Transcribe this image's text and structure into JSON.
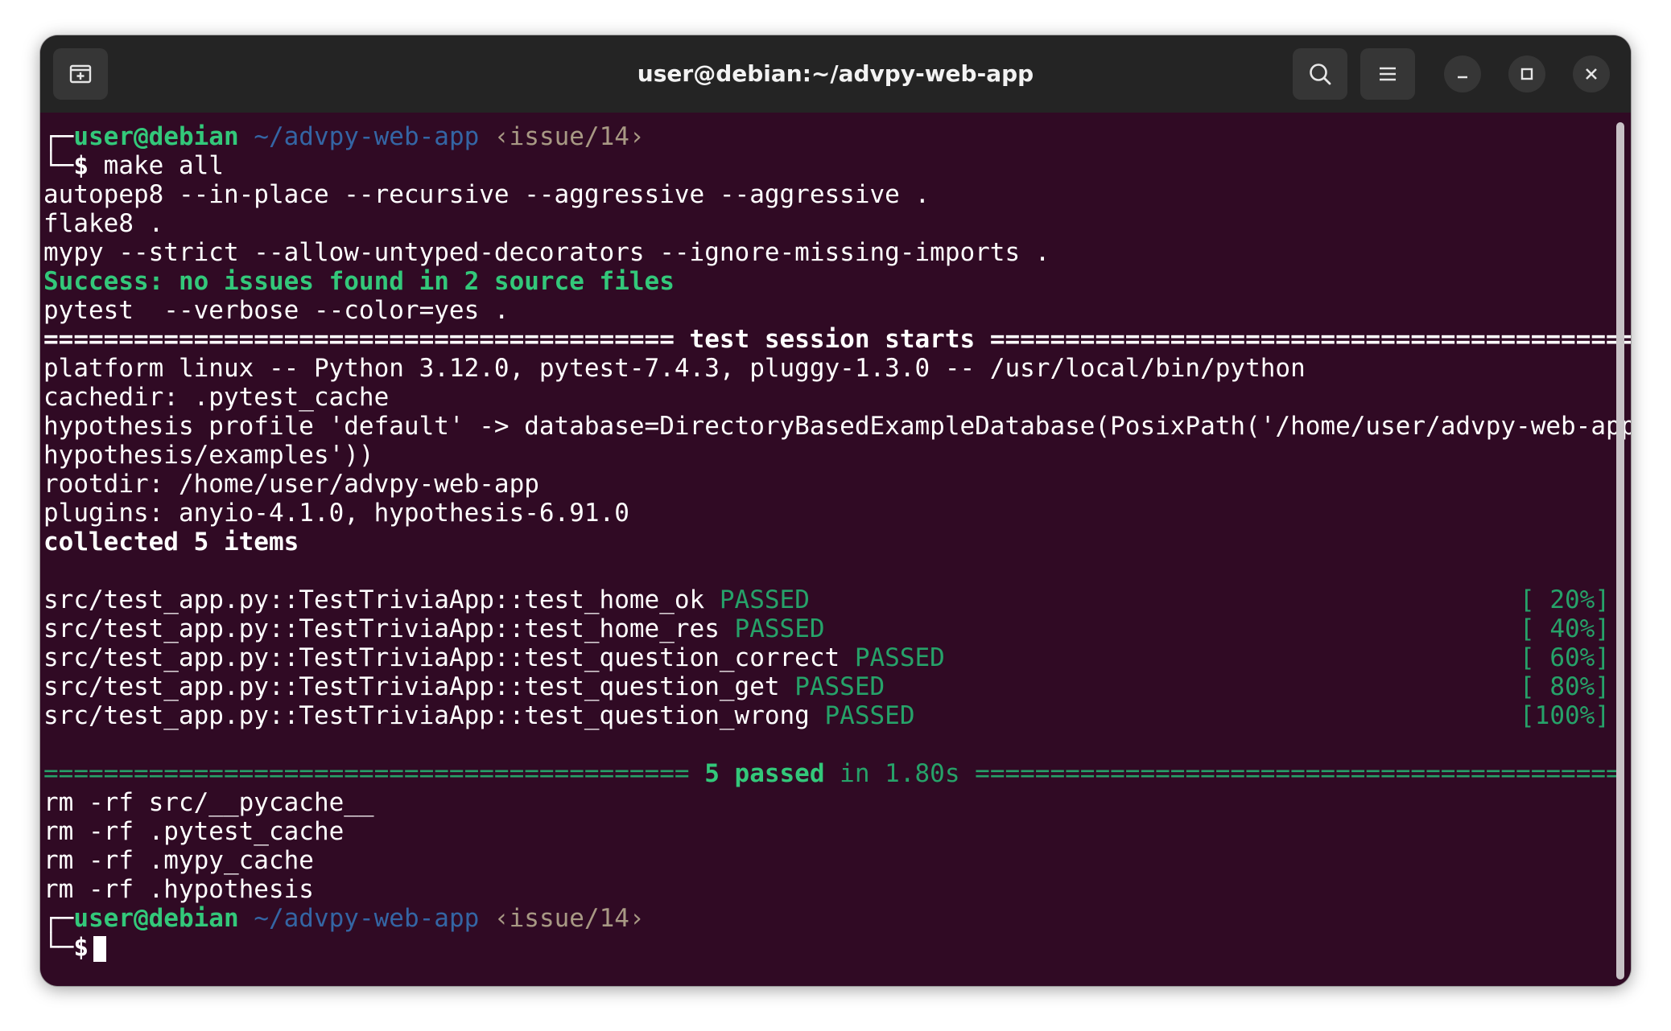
{
  "window": {
    "title": "user@debian:~/advpy-web-app"
  },
  "titlebar": {
    "icons": [
      "new-tab-icon",
      "search-icon",
      "hamburger-menu-icon",
      "minimize-icon",
      "maximize-icon",
      "close-icon"
    ]
  },
  "colors": {
    "background": "#300a24",
    "titlebar": "#242424",
    "green": "#26a269",
    "blue": "#3465a4",
    "branch": "#a89984"
  },
  "prompt1": {
    "corner_top": "┌─",
    "user": "user@debian",
    "path": "~/advpy-web-app",
    "branch": "‹issue/14›",
    "corner_bottom": "└─",
    "symbol": "$",
    "command": "make all"
  },
  "output": {
    "autopep8": "autopep8 --in-place --recursive --aggressive --aggressive .",
    "flake8": "flake8 .",
    "mypy": "mypy --strict --allow-untyped-decorators --ignore-missing-imports .",
    "mypy_success": "Success: no issues found in 2 source files",
    "pytest": "pytest  --verbose --color=yes .",
    "session_left": "========================================== ",
    "session_label": "test session starts",
    "session_right": " ===========================================",
    "platform": "platform linux -- Python 3.12.0, pytest-7.4.3, pluggy-1.3.0 -- /usr/local/bin/python",
    "cachedir": "cachedir: .pytest_cache",
    "hypothesis_1": "hypothesis profile 'default' -> database=DirectoryBasedExampleDatabase(PosixPath('/home/user/advpy-web-app/.",
    "hypothesis_2": "hypothesis/examples'))",
    "rootdir": "rootdir: /home/user/advpy-web-app",
    "plugins": "plugins: anyio-4.1.0, hypothesis-6.91.0",
    "collected": "collected 5 items"
  },
  "tests": [
    {
      "name": "src/test_app.py::TestTriviaApp::test_home_ok",
      "status": "PASSED",
      "open": "[",
      "pct": " 20%",
      "close": "]"
    },
    {
      "name": "src/test_app.py::TestTriviaApp::test_home_res",
      "status": "PASSED",
      "open": "[",
      "pct": " 40%",
      "close": "]"
    },
    {
      "name": "src/test_app.py::TestTriviaApp::test_question_correct",
      "status": "PASSED",
      "open": "[",
      "pct": " 60%",
      "close": "]"
    },
    {
      "name": "src/test_app.py::TestTriviaApp::test_question_get",
      "status": "PASSED",
      "open": "[",
      "pct": " 80%",
      "close": "]"
    },
    {
      "name": "src/test_app.py::TestTriviaApp::test_question_wrong",
      "status": "PASSED",
      "open": "[",
      "pct": "100%",
      "close": "]"
    }
  ],
  "summary": {
    "left": "=========================================== ",
    "passed": "5 passed",
    "in": " in 1.80s ",
    "right": "==========================================="
  },
  "cleanup": [
    "rm -rf src/__pycache__",
    "rm -rf .pytest_cache",
    "rm -rf .mypy_cache",
    "rm -rf .hypothesis"
  ],
  "prompt2": {
    "corner_top": "┌─",
    "user": "user@debian",
    "path": "~/advpy-web-app",
    "branch": "‹issue/14›",
    "corner_bottom": "└─",
    "symbol": "$"
  }
}
